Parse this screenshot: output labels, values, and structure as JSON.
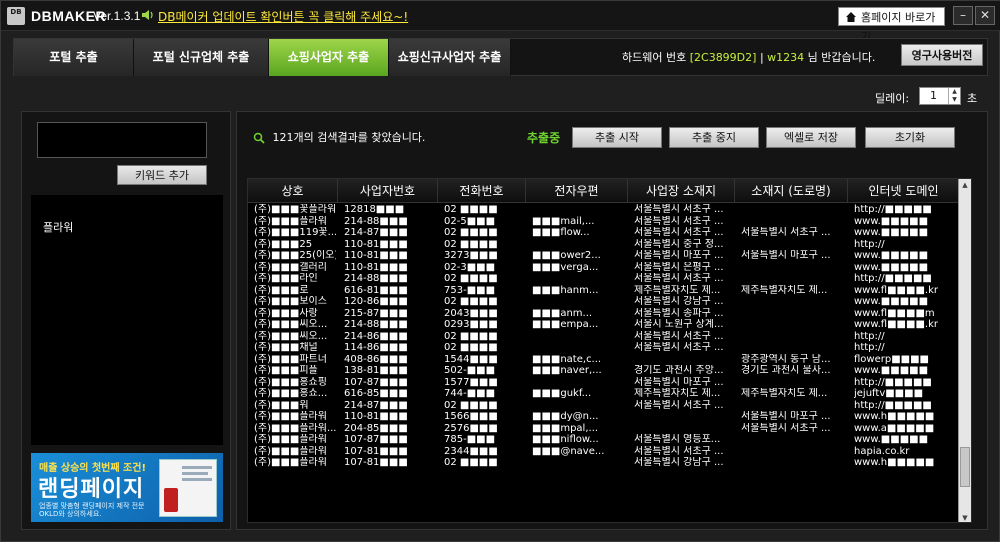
{
  "titlebar": {
    "logo": "DB",
    "brand": "DBMAKER",
    "version": "Ver.1.3.1",
    "notice": "DB메이커 업데이트 확인버튼 꼭 클릭해 주세요~!",
    "home_button": "홈페이지 바로가기",
    "minimize": "–",
    "close": "✕"
  },
  "tabs": [
    {
      "label": "포털 추출"
    },
    {
      "label": "포털 신규업체 추출"
    },
    {
      "label": "쇼핑사업자 추출"
    },
    {
      "label": "쇼핑신규사업자 추출"
    }
  ],
  "header": {
    "hw_prefix": "하드웨어 번호",
    "hw_code": "[2C3899D2]",
    "separator": "|",
    "user_name": "w1234",
    "greeting": "님 반갑습니다.",
    "license_button": "영구사용버전"
  },
  "delay": {
    "label": "딜레이:",
    "value": "1",
    "unit": "초"
  },
  "left": {
    "keyword_input_value": "",
    "add_keyword_button": "키워드 추가",
    "keywords": [
      "플라워"
    ],
    "ad": {
      "top": "매출 상승의 첫번째 조건!",
      "main": "랜딩페이지",
      "sub": "업종별 맞춤형 랜딩페이지 제작 전문 OKLD와 상의하세요."
    }
  },
  "main": {
    "found_text": "121개의 검색결과를 찾았습니다.",
    "status": "추출중",
    "buttons": {
      "start": "추출 시작",
      "stop": "추출 중지",
      "excel": "엑셀로 저장",
      "reset": "초기화"
    },
    "columns": [
      "상호",
      "사업자번호",
      "전화번호",
      "전자우편",
      "사업장 소재지",
      "소재지 (도로명)",
      "인터넷 도메인"
    ],
    "rows": [
      [
        "(주)■■■꽃플라워",
        "12818■■■",
        "02 ■■■■",
        "",
        "서울특별시 서초구 ...",
        "",
        "http://■■■■■"
      ],
      [
        "(주)■■■플라워",
        "214-88■■■",
        "02-5■■■",
        "■■■mail,...",
        "서울특별시 서초구 ...",
        "",
        "www.■■■■■"
      ],
      [
        "(주)■■■119꽃...",
        "214-87■■■",
        "02 ■■■■",
        "■■■flow...",
        "서울특별시 서초구 ...",
        "서울특별시 서초구 ...",
        "www.■■■■■"
      ],
      [
        "(주)■■■25",
        "110-81■■■",
        "02 ■■■■",
        "",
        "서울특별시 중구 정...",
        "",
        "http://"
      ],
      [
        "(주)■■■25(이오)",
        "110-81■■■",
        "3273■■■",
        "■■■ower2...",
        "서울특별시 마포구 ...",
        "서울특별시 마포구 ...",
        "www.■■■■■"
      ],
      [
        "(주)■■■갤러리",
        "110-81■■■",
        "02-3■■■",
        "■■■verga...",
        "서울특별시 은평구 ...",
        "",
        "www.■■■■■"
      ],
      [
        "(주)■■■라인",
        "214-88■■■",
        "02 ■■■■",
        "",
        "서울특별시 서초구 ...",
        "",
        "http://■■■■■"
      ],
      [
        "(주)■■■로",
        "616-81■■■",
        "753-■■■",
        "■■■hanm...",
        "제주특별자치도 제...",
        "제주특별자치도 제...",
        "www.fl■■■■.kr"
      ],
      [
        "(주)■■■보이스",
        "120-86■■■",
        "02 ■■■■",
        "",
        "서울특별시 강남구 ...",
        "",
        "www.■■■■■"
      ],
      [
        "(주)■■■사랑",
        "215-87■■■",
        "2043■■■",
        "■■■anm...",
        "서울특별시 송파구 ...",
        "",
        "www.fl■■■■m"
      ],
      [
        "(주)■■■씨오...",
        "214-88■■■",
        "0293■■■",
        "■■■empa...",
        "서울시 노원구 상계...",
        "",
        "www.fl■■■■.kr"
      ],
      [
        "(주)■■■씨오...",
        "214-86■■■",
        "02 ■■■■",
        "",
        "서울특별시 서초구 ...",
        "",
        "http://"
      ],
      [
        "(주)■■■채널",
        "114-86■■■",
        "02 ■■■■",
        "",
        "서울특별시 서초구 ...",
        "",
        "http://"
      ],
      [
        "(주)■■■파트너",
        "408-86■■■",
        "1544■■■",
        "■■■nate,c...",
        "",
        "광주광역시 동구 남...",
        "flowerp■■■■"
      ],
      [
        "(주)■■■피플",
        "138-81■■■",
        "502-■■■",
        "■■■naver,...",
        "경기도 과천시 주앙...",
        "경기도 과천시 물사...",
        "www.■■■■■"
      ],
      [
        "(주)■■■홍쇼핑",
        "107-87■■■",
        "1577■■■",
        "",
        "서울특별시 마포구 ...",
        "",
        "http://■■■■■"
      ],
      [
        "(주)■■■홍쇼...",
        "616-85■■■",
        "744-■■■",
        "■■■gukf...",
        "제주특별자치도 제...",
        "제주특별자치도 제...",
        "jejuftv■■■■"
      ],
      [
        "(주)■■■워",
        "214-87■■■",
        "02 ■■■■",
        "",
        "서울특별시 서초구 ...",
        "",
        "http://■■■■■"
      ],
      [
        "(주)■■■플라워",
        "110-81■■■",
        "1566■■■",
        "■■■dy@n...",
        "",
        "서울특별시 마포구 ...",
        "www.h■■■■■"
      ],
      [
        "(주)■■■플라워...",
        "204-85■■■",
        "2576■■■",
        "■■■mpal,...",
        "",
        "서울특별시 서초구 ...",
        "www.a■■■■■"
      ],
      [
        "(주)■■■플라워",
        "107-87■■■",
        "785-■■■",
        "■■■niflow...",
        "서울특별시 영등포...",
        "",
        "www.■■■■■"
      ],
      [
        "(주)■■■플라워",
        "107-81■■■",
        "2344■■■",
        "■■■@nave...",
        "서울특별시 서초구 ...",
        "",
        "hapia.co.kr"
      ],
      [
        "(주)■■■플라워",
        "107-81■■■",
        "02 ■■■■",
        "",
        "서울특별시 강남구 ...",
        "",
        "www.h■■■■■"
      ]
    ]
  },
  "colors": {
    "accent": "#6fd330",
    "tab_active": "#7cbf35",
    "highlight": "#c8f03c",
    "notice": "#ffea3a"
  }
}
